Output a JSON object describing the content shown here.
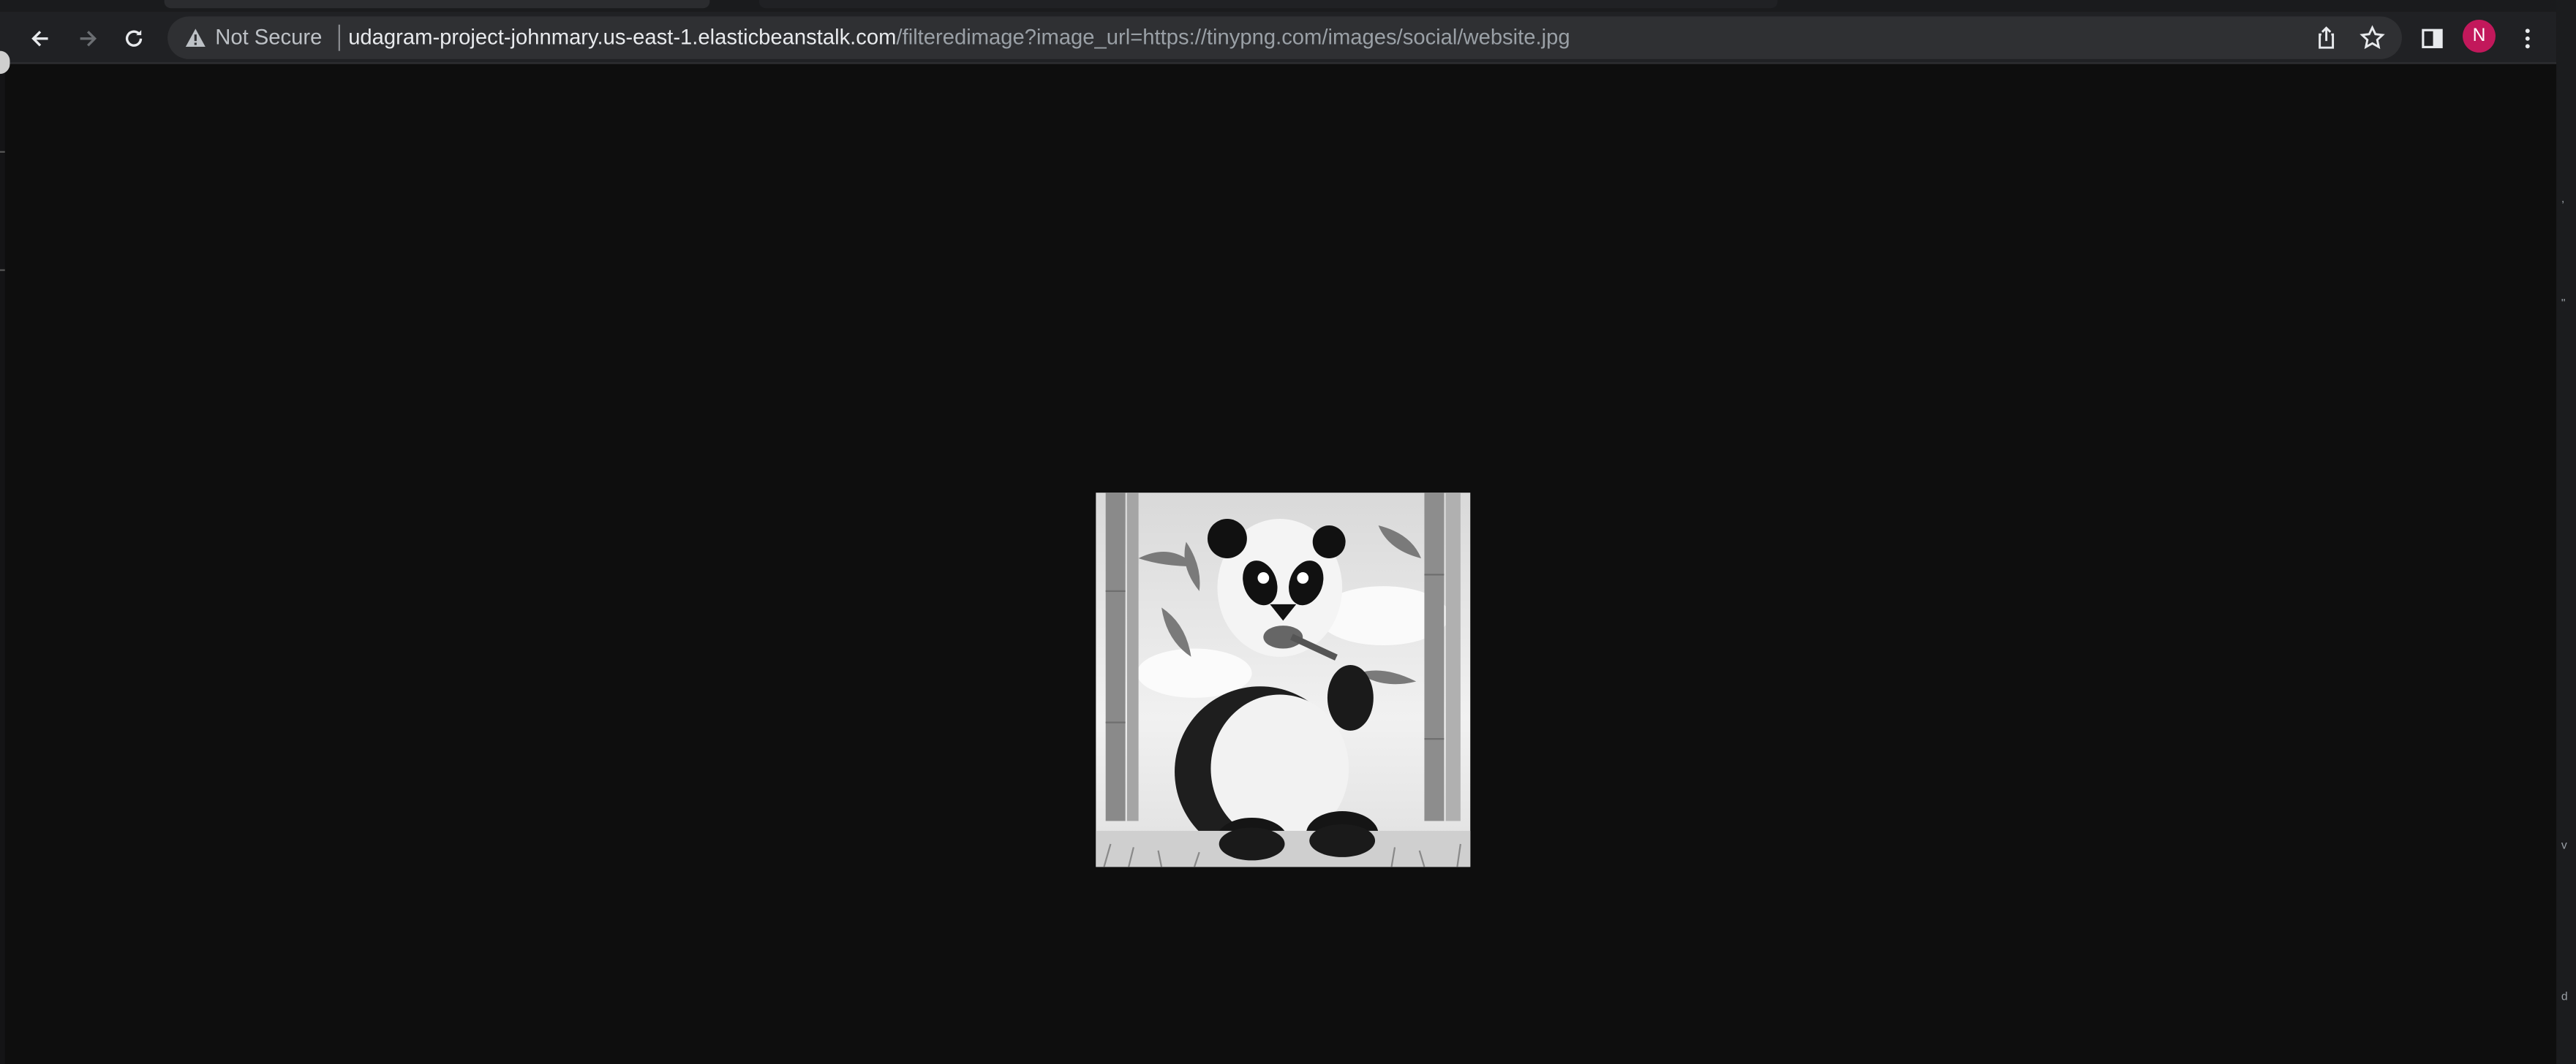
{
  "browser": {
    "nav": {
      "back_icon": "arrow-left-icon",
      "forward_icon": "arrow-right-icon",
      "reload_icon": "reload-icon"
    },
    "omnibox": {
      "security_icon": "warning-triangle-icon",
      "security_text": "Not Secure",
      "url_host": "udagram-project-johnmary.us-east-1.elasticbeanstalk.com",
      "url_path": "/filteredimage?image_url=https://tinypng.com/images/social/website.jpg",
      "share_icon": "share-icon",
      "bookmark_icon": "star-icon"
    },
    "side_panel_icon": "side-panel-icon",
    "profile_initial": "N",
    "menu_icon": "kebab-menu-icon"
  },
  "page": {
    "image_subject": "grayscale panda illustration",
    "background_color": "#0e0e0e"
  },
  "colors": {
    "toolbar": "#202124",
    "omnibox": "#2f3033",
    "avatar": "#c2185b"
  }
}
